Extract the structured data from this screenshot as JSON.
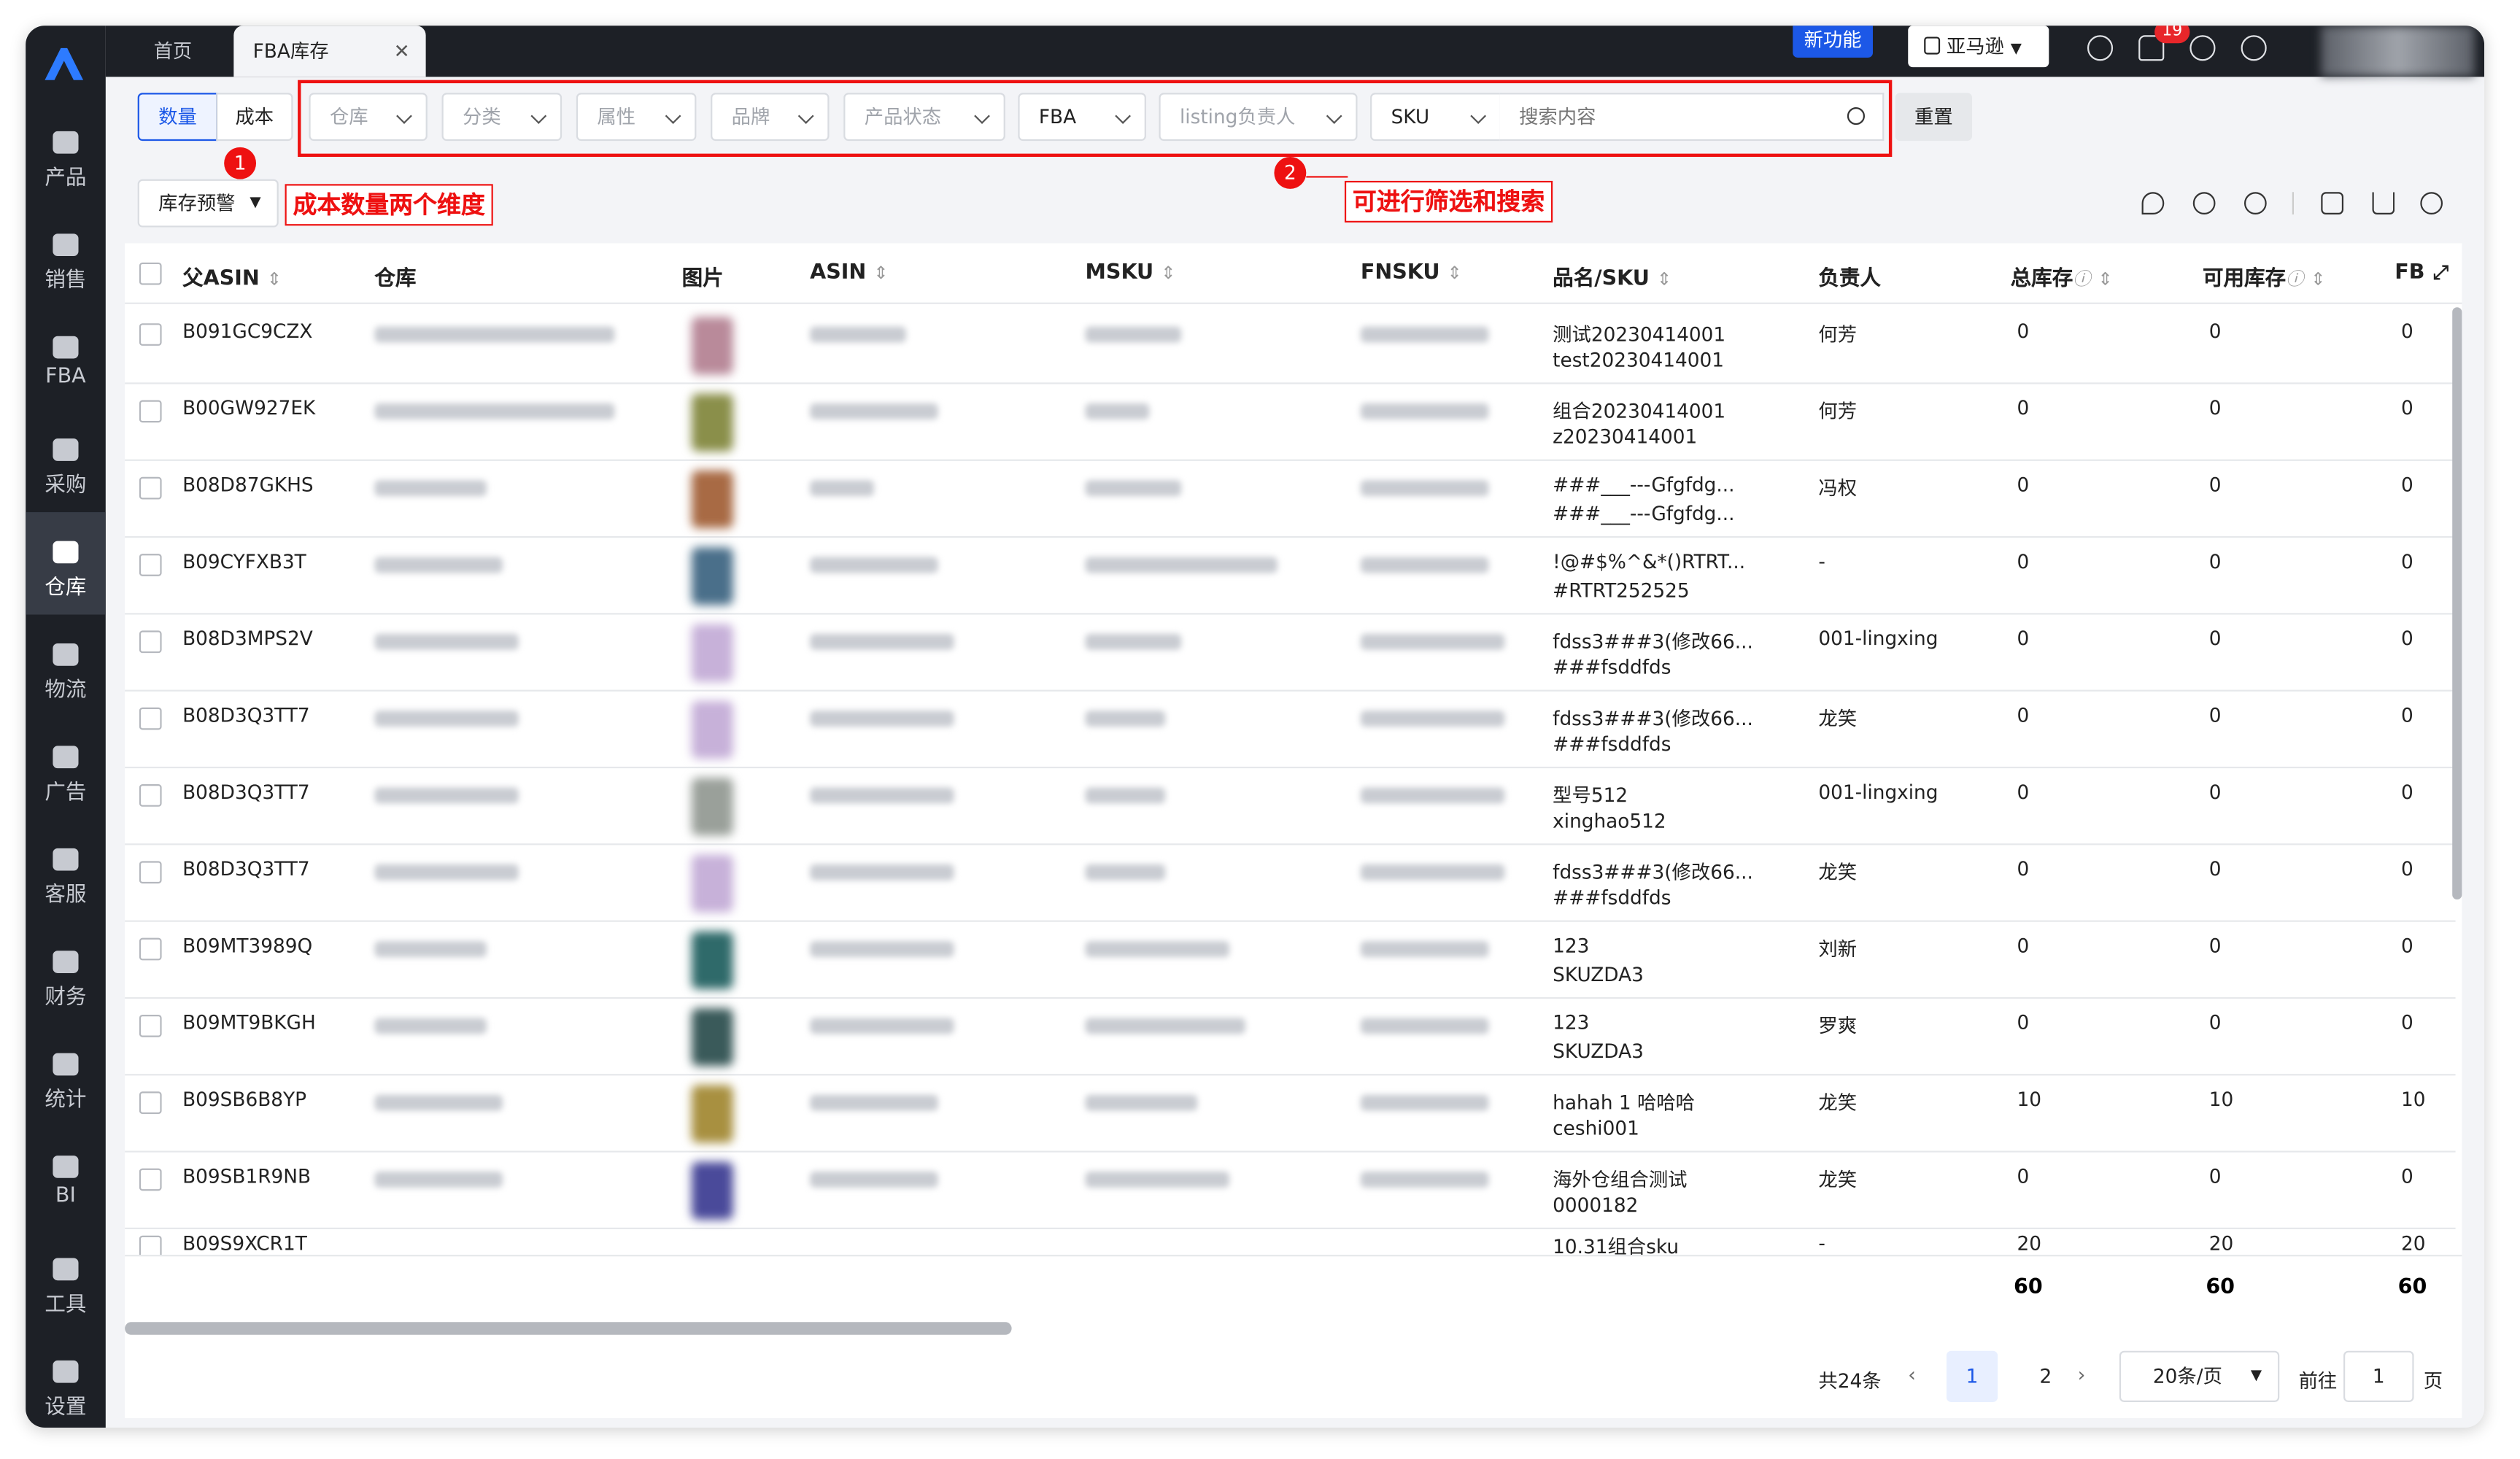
{
  "sidebar": {
    "items": [
      {
        "label": "产品",
        "icon": "box-icon"
      },
      {
        "label": "销售",
        "icon": "sell-icon"
      },
      {
        "label": "FBA",
        "icon": "fba-icon"
      },
      {
        "label": "采购",
        "icon": "cart-icon"
      },
      {
        "label": "仓库",
        "icon": "warehouse-icon"
      },
      {
        "label": "物流",
        "icon": "truck-icon"
      },
      {
        "label": "广告",
        "icon": "ad-icon"
      },
      {
        "label": "客服",
        "icon": "mail-icon"
      },
      {
        "label": "财务",
        "icon": "yen-icon"
      },
      {
        "label": "统计",
        "icon": "pie-icon"
      },
      {
        "label": "BI",
        "icon": "chart-icon"
      },
      {
        "label": "工具",
        "icon": "tool-icon"
      },
      {
        "label": "设置",
        "icon": "gear-icon"
      }
    ]
  },
  "tabs": {
    "home": "首页",
    "fba": "FBA库存"
  },
  "header": {
    "new_feature": "新功能",
    "store": "亚马逊",
    "notif_count": "19"
  },
  "toolbar": {
    "qty": "数量",
    "cost": "成本",
    "warehouse": "仓库",
    "category": "分类",
    "attr": "属性",
    "brand": "品牌",
    "status": "产品状态",
    "fba": "FBA",
    "listing": "listing负责人",
    "sku": "SKU",
    "search_placeholder": "搜索内容",
    "reset": "重置",
    "stock_alert": "库存预警"
  },
  "annotations": {
    "a1_num": "1",
    "a1_text": "成本数量两个维度",
    "a2_num": "2",
    "a2_text": "可进行筛选和搜索"
  },
  "columns": {
    "parent_asin": "父ASIN",
    "warehouse": "仓库",
    "image": "图片",
    "asin": "ASIN",
    "msku": "MSKU",
    "fnsku": "FNSKU",
    "name_sku": "品名/SKU",
    "owner": "负责人",
    "total": "总库存",
    "available": "可用库存",
    "fb": "FB"
  },
  "rows": [
    {
      "asin": "B091GC9CZX",
      "name": "测试20230414001",
      "sku": "test20230414001",
      "owner": "何芳",
      "total": "0",
      "avail": "0",
      "fb": "0"
    },
    {
      "asin": "B00GW927EK",
      "name": "组合20230414001",
      "sku": "z20230414001",
      "owner": "何芳",
      "total": "0",
      "avail": "0",
      "fb": "0"
    },
    {
      "asin": "B08D87GKHS",
      "name": "###___---Gfgfdg...",
      "sku": "###___---Gfgfdg...",
      "owner": "冯权",
      "total": "0",
      "avail": "0",
      "fb": "0"
    },
    {
      "asin": "B09CYFXB3T",
      "name": "!@#$%^&*()RTRT...",
      "sku": "#RTRT252525",
      "owner": "-",
      "total": "0",
      "avail": "0",
      "fb": "0"
    },
    {
      "asin": "B08D3MPS2V",
      "name": "fdss3###3(修改66...",
      "sku": "###fsddfds",
      "owner": "001-lingxing",
      "total": "0",
      "avail": "0",
      "fb": "0"
    },
    {
      "asin": "B08D3Q3TT7",
      "name": "fdss3###3(修改66...",
      "sku": "###fsddfds",
      "owner": "龙笑",
      "total": "0",
      "avail": "0",
      "fb": "0"
    },
    {
      "asin": "B08D3Q3TT7",
      "name": "型号512",
      "sku": "xinghao512",
      "owner": "001-lingxing",
      "total": "0",
      "avail": "0",
      "fb": "0"
    },
    {
      "asin": "B08D3Q3TT7",
      "name": "fdss3###3(修改66...",
      "sku": "###fsddfds",
      "owner": "龙笑",
      "total": "0",
      "avail": "0",
      "fb": "0"
    },
    {
      "asin": "B09MT3989Q",
      "name": "123",
      "sku": "SKUZDA3",
      "owner": "刘新",
      "total": "0",
      "avail": "0",
      "fb": "0"
    },
    {
      "asin": "B09MT9BKGH",
      "name": "123",
      "sku": "SKUZDA3",
      "owner": "罗爽",
      "total": "0",
      "avail": "0",
      "fb": "0"
    },
    {
      "asin": "B09SB6B8YP",
      "name": "hahah 1 哈哈哈",
      "sku": "ceshi001",
      "owner": "龙笑",
      "total": "10",
      "avail": "10",
      "fb": "10"
    },
    {
      "asin": "B09SB1R9NB",
      "name": "海外仓组合测试",
      "sku": "0000182",
      "owner": "龙笑",
      "total": "0",
      "avail": "0",
      "fb": "0"
    }
  ],
  "partial_row": {
    "asin": "B09S9XCR1T",
    "name": "10.31组合sku",
    "owner": "-",
    "total": "20",
    "avail": "20",
    "fb": "20"
  },
  "totals": {
    "total": "60",
    "avail": "60",
    "fb": "60"
  },
  "pagination": {
    "count": "共24条",
    "page1": "1",
    "page2": "2",
    "per_page": "20条/页",
    "goto": "前往",
    "page_input": "1",
    "page_unit": "页"
  },
  "colors": {
    "accent": "#1c58e7",
    "annotation": "#e11111",
    "sidebar": "#1d2026"
  }
}
